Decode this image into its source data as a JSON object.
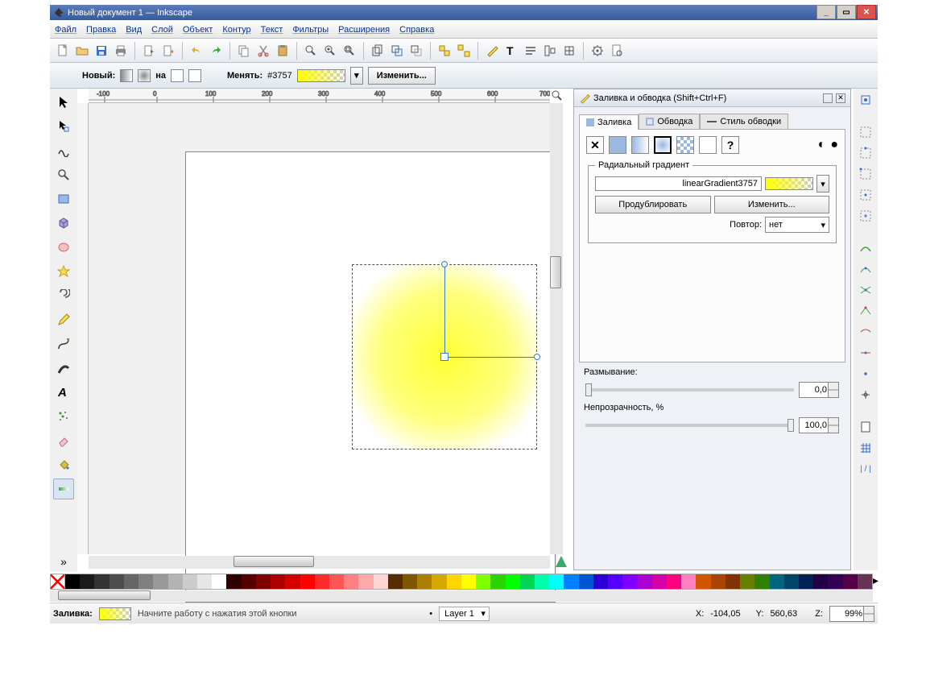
{
  "window": {
    "title": "Новый документ 1 — Inkscape"
  },
  "menu": {
    "file": "Файл",
    "edit": "Правка",
    "view": "Вид",
    "layer": "Слой",
    "object": "Объект",
    "path": "Контур",
    "text": "Текст",
    "filters": "Фильтры",
    "extensions": "Расширения",
    "help": "Справка"
  },
  "tooloptions": {
    "new_label": "Новый:",
    "on_label": "на",
    "change_label": "Менять:",
    "grad_id": "#3757",
    "edit_label": "Изменить..."
  },
  "fillstroke": {
    "title": "Заливка и обводка (Shift+Ctrl+F)",
    "tab_fill": "Заливка",
    "tab_stroke": "Обводка",
    "tab_strokestyle": "Стиль обводки",
    "group_label": "Радиальный градиент",
    "grad_name": "linearGradient3757",
    "dup_btn": "Продублировать",
    "edit_btn": "Изменить...",
    "repeat_label": "Повтор:",
    "repeat_value": "нет",
    "blur_label": "Размывание:",
    "blur_value": "0,0",
    "opacity_label": "Непрозрачность, %",
    "opacity_value": "100,0"
  },
  "status": {
    "fill_label": "Заливка:",
    "hint": "Начните работу с нажатия этой кнопки",
    "layer": "Layer 1",
    "x_label": "X:",
    "x_val": "-104,05",
    "y_label": "Y:",
    "y_val": "560,63",
    "z_label": "Z:",
    "z_val": "99%"
  },
  "palette_colors": [
    "#000000",
    "#1a1a1a",
    "#333333",
    "#4d4d4d",
    "#666666",
    "#808080",
    "#999999",
    "#b3b3b3",
    "#cccccc",
    "#e6e6e6",
    "#ffffff",
    "#2f0000",
    "#550000",
    "#800000",
    "#aa0000",
    "#d40000",
    "#ff0000",
    "#ff2a2a",
    "#ff5555",
    "#ff8080",
    "#ffaaaa",
    "#ffd5d5",
    "#552b00",
    "#805500",
    "#aa8000",
    "#d4aa00",
    "#ffd500",
    "#ffff00",
    "#80ff00",
    "#2ad400",
    "#00ff00",
    "#00d455",
    "#00ffaa",
    "#00ffff",
    "#0080ff",
    "#0055d4",
    "#2a00d4",
    "#5500ff",
    "#8000ff",
    "#aa00d4",
    "#d400aa",
    "#ff0080",
    "#ff80c0",
    "#d45500",
    "#aa4400",
    "#803300",
    "#668000",
    "#338000",
    "#006680",
    "#004466",
    "#002255",
    "#220044",
    "#330055",
    "#550044",
    "#663355"
  ]
}
